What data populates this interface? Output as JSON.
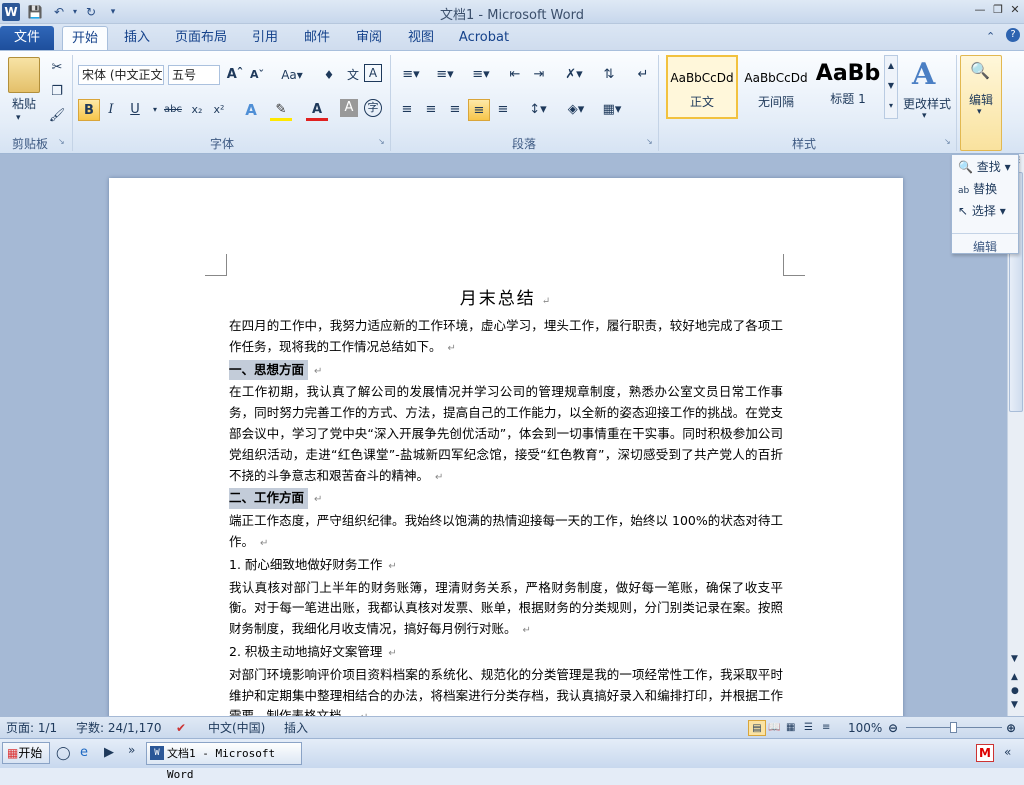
{
  "titlebar": {
    "title": "文档1  -  Microsoft Word",
    "app_icon": "W",
    "qa_icons": [
      "save-icon",
      "undo-icon",
      "redo-icon",
      "customize-icon"
    ]
  },
  "tabs": {
    "file": "文件",
    "items": [
      "开始",
      "插入",
      "页面布局",
      "引用",
      "邮件",
      "审阅",
      "视图",
      "Acrobat"
    ]
  },
  "ribbon": {
    "clipboard": {
      "label": "剪贴板",
      "paste": "粘贴"
    },
    "font": {
      "label": "字体",
      "font_name": "宋体 (中文正文",
      "font_size": "五号"
    },
    "paragraph": {
      "label": "段落"
    },
    "styles": {
      "label": "样式",
      "items": [
        {
          "preview": "AaBbCcDd",
          "name": "正文"
        },
        {
          "preview": "AaBbCcDd",
          "name": "无间隔"
        },
        {
          "preview": "AaBb",
          "name": "标题 1"
        }
      ],
      "change": "更改样式"
    },
    "editing": {
      "label": "编辑",
      "button": "编辑"
    }
  },
  "edit_popup": {
    "find": "查找",
    "replace": "替换",
    "select": "选择",
    "label": "编辑"
  },
  "document": {
    "title": "月末总结",
    "p1": "在四月的工作中，我努力适应新的工作环境，虚心学习，埋头工作，履行职责，较好地完成了各项工作任务，现将我的工作情况总结如下。",
    "h1": "一、思想方面",
    "p2": "在工作初期，我认真了解公司的发展情况并学习公司的管理规章制度，熟悉办公室文员日常工作事务，同时努力完善工作的方式、方法，提高自己的工作能力，以全新的姿态迎接工作的挑战。在党支部会议中，学习了党中央“深入开展争先创优活动”，体会到一切事情重在干实事。同时积极参加公司党组织活动，走进“红色课堂”-盐城新四军纪念馆，接受“红色教育”，深切感受到了共产党人的百折不挠的斗争意志和艰苦奋斗的精神。",
    "h2": "二、工作方面",
    "p3": "端正工作态度，严守组织纪律。我始终以饱满的热情迎接每一天的工作，始终以 100%的状态对待工作。",
    "l1": "1.  耐心细致地做好财务工作",
    "p4": "我认真核对部门上半年的财务账簿，理清财务关系，严格财务制度，做好每一笔账，确保了收支平衡。对于每一笔进出账，我都认真核对发票、账单，根据财务的分类规则，分门别类记录在案。按照财务制度，我细化月收支情况，搞好每月例行对账。",
    "l2": "2.  积极主动地搞好文案管理",
    "p5": "对部门环境影响评价项目资料档案的系统化、规范化的分类管理是我的一项经常性工作，我采取平时维护和定期集中整理相结合的办法，将档案进行分类存档，我认真搞好录入和编排打印，并根据工作需要，制作表格文档。"
  },
  "status": {
    "page": "页面: 1/1",
    "words": "字数: 24/1,170",
    "lang": "中文(中国)",
    "mode": "插入",
    "zoom": "100%"
  },
  "taskbar": {
    "start": "开始",
    "window": "文档1 - Microsoft Word"
  }
}
